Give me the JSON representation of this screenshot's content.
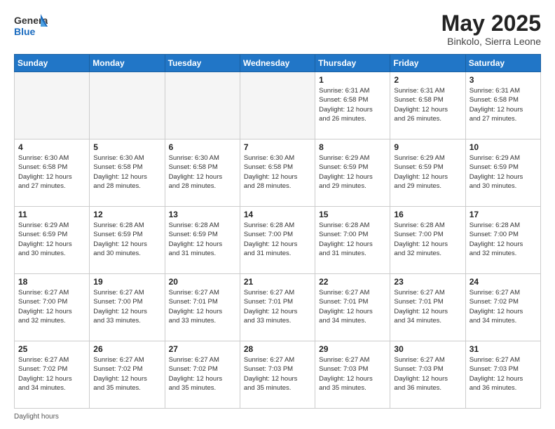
{
  "header": {
    "logo_general": "General",
    "logo_blue": "Blue",
    "month_title": "May 2025",
    "location": "Binkolo, Sierra Leone"
  },
  "days_of_week": [
    "Sunday",
    "Monday",
    "Tuesday",
    "Wednesday",
    "Thursday",
    "Friday",
    "Saturday"
  ],
  "weeks": [
    [
      {
        "day": "",
        "info": ""
      },
      {
        "day": "",
        "info": ""
      },
      {
        "day": "",
        "info": ""
      },
      {
        "day": "",
        "info": ""
      },
      {
        "day": "1",
        "info": "Sunrise: 6:31 AM\nSunset: 6:58 PM\nDaylight: 12 hours\nand 26 minutes."
      },
      {
        "day": "2",
        "info": "Sunrise: 6:31 AM\nSunset: 6:58 PM\nDaylight: 12 hours\nand 26 minutes."
      },
      {
        "day": "3",
        "info": "Sunrise: 6:31 AM\nSunset: 6:58 PM\nDaylight: 12 hours\nand 27 minutes."
      }
    ],
    [
      {
        "day": "4",
        "info": "Sunrise: 6:30 AM\nSunset: 6:58 PM\nDaylight: 12 hours\nand 27 minutes."
      },
      {
        "day": "5",
        "info": "Sunrise: 6:30 AM\nSunset: 6:58 PM\nDaylight: 12 hours\nand 28 minutes."
      },
      {
        "day": "6",
        "info": "Sunrise: 6:30 AM\nSunset: 6:58 PM\nDaylight: 12 hours\nand 28 minutes."
      },
      {
        "day": "7",
        "info": "Sunrise: 6:30 AM\nSunset: 6:58 PM\nDaylight: 12 hours\nand 28 minutes."
      },
      {
        "day": "8",
        "info": "Sunrise: 6:29 AM\nSunset: 6:59 PM\nDaylight: 12 hours\nand 29 minutes."
      },
      {
        "day": "9",
        "info": "Sunrise: 6:29 AM\nSunset: 6:59 PM\nDaylight: 12 hours\nand 29 minutes."
      },
      {
        "day": "10",
        "info": "Sunrise: 6:29 AM\nSunset: 6:59 PM\nDaylight: 12 hours\nand 30 minutes."
      }
    ],
    [
      {
        "day": "11",
        "info": "Sunrise: 6:29 AM\nSunset: 6:59 PM\nDaylight: 12 hours\nand 30 minutes."
      },
      {
        "day": "12",
        "info": "Sunrise: 6:28 AM\nSunset: 6:59 PM\nDaylight: 12 hours\nand 30 minutes."
      },
      {
        "day": "13",
        "info": "Sunrise: 6:28 AM\nSunset: 6:59 PM\nDaylight: 12 hours\nand 31 minutes."
      },
      {
        "day": "14",
        "info": "Sunrise: 6:28 AM\nSunset: 7:00 PM\nDaylight: 12 hours\nand 31 minutes."
      },
      {
        "day": "15",
        "info": "Sunrise: 6:28 AM\nSunset: 7:00 PM\nDaylight: 12 hours\nand 31 minutes."
      },
      {
        "day": "16",
        "info": "Sunrise: 6:28 AM\nSunset: 7:00 PM\nDaylight: 12 hours\nand 32 minutes."
      },
      {
        "day": "17",
        "info": "Sunrise: 6:28 AM\nSunset: 7:00 PM\nDaylight: 12 hours\nand 32 minutes."
      }
    ],
    [
      {
        "day": "18",
        "info": "Sunrise: 6:27 AM\nSunset: 7:00 PM\nDaylight: 12 hours\nand 32 minutes."
      },
      {
        "day": "19",
        "info": "Sunrise: 6:27 AM\nSunset: 7:00 PM\nDaylight: 12 hours\nand 33 minutes."
      },
      {
        "day": "20",
        "info": "Sunrise: 6:27 AM\nSunset: 7:01 PM\nDaylight: 12 hours\nand 33 minutes."
      },
      {
        "day": "21",
        "info": "Sunrise: 6:27 AM\nSunset: 7:01 PM\nDaylight: 12 hours\nand 33 minutes."
      },
      {
        "day": "22",
        "info": "Sunrise: 6:27 AM\nSunset: 7:01 PM\nDaylight: 12 hours\nand 34 minutes."
      },
      {
        "day": "23",
        "info": "Sunrise: 6:27 AM\nSunset: 7:01 PM\nDaylight: 12 hours\nand 34 minutes."
      },
      {
        "day": "24",
        "info": "Sunrise: 6:27 AM\nSunset: 7:02 PM\nDaylight: 12 hours\nand 34 minutes."
      }
    ],
    [
      {
        "day": "25",
        "info": "Sunrise: 6:27 AM\nSunset: 7:02 PM\nDaylight: 12 hours\nand 34 minutes."
      },
      {
        "day": "26",
        "info": "Sunrise: 6:27 AM\nSunset: 7:02 PM\nDaylight: 12 hours\nand 35 minutes."
      },
      {
        "day": "27",
        "info": "Sunrise: 6:27 AM\nSunset: 7:02 PM\nDaylight: 12 hours\nand 35 minutes."
      },
      {
        "day": "28",
        "info": "Sunrise: 6:27 AM\nSunset: 7:03 PM\nDaylight: 12 hours\nand 35 minutes."
      },
      {
        "day": "29",
        "info": "Sunrise: 6:27 AM\nSunset: 7:03 PM\nDaylight: 12 hours\nand 35 minutes."
      },
      {
        "day": "30",
        "info": "Sunrise: 6:27 AM\nSunset: 7:03 PM\nDaylight: 12 hours\nand 36 minutes."
      },
      {
        "day": "31",
        "info": "Sunrise: 6:27 AM\nSunset: 7:03 PM\nDaylight: 12 hours\nand 36 minutes."
      }
    ]
  ],
  "footer": {
    "daylight_label": "Daylight hours"
  }
}
